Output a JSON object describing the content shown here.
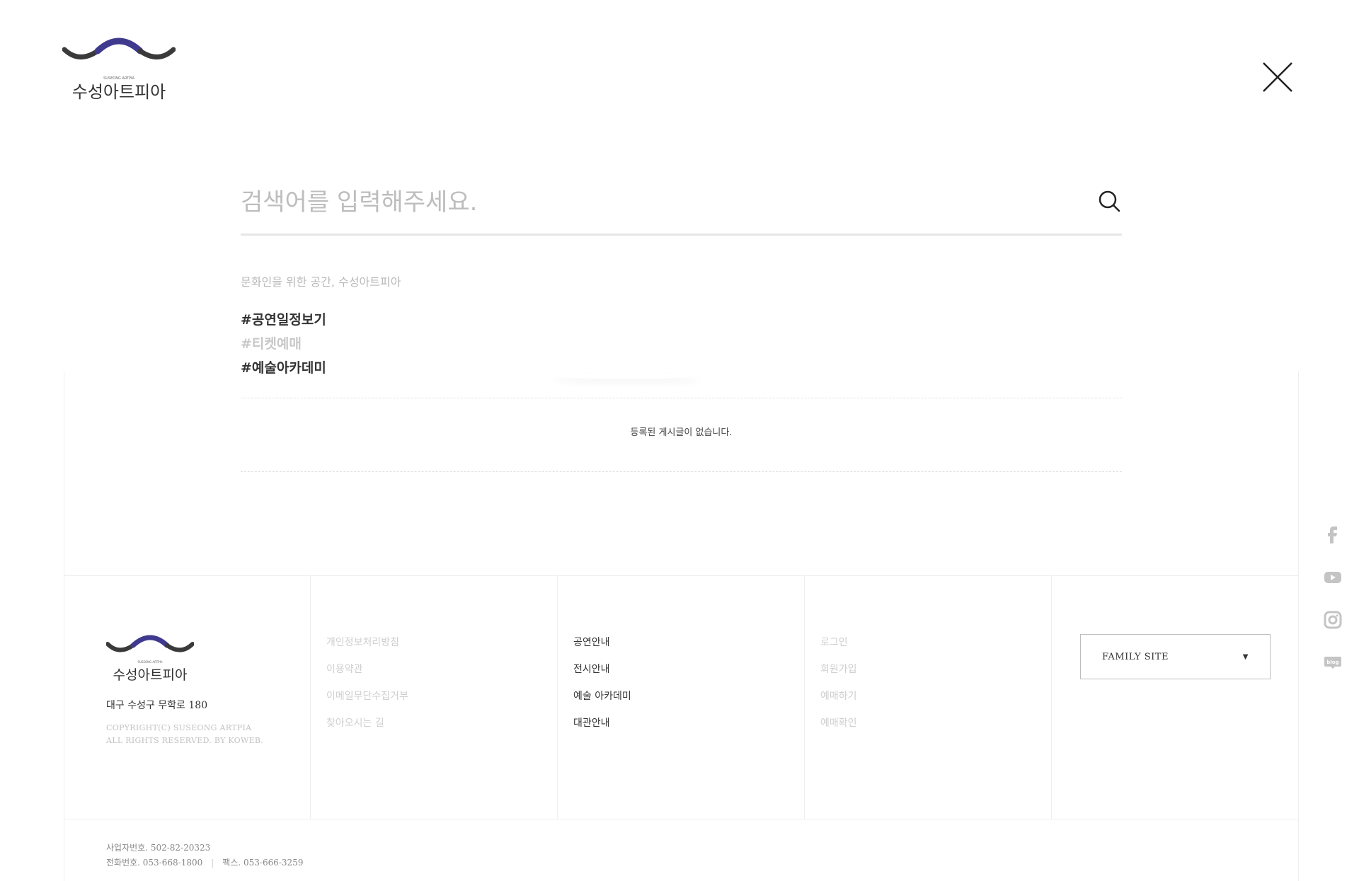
{
  "logo": {
    "subtitle": "SUSEONG ARTPIA",
    "name": "수성아트피아",
    "colors": {
      "arc_left": "#3a3a3a",
      "arc_center": "#3f3a8e",
      "arc_right": "#3a3a3a"
    }
  },
  "search": {
    "placeholder": "검색어를 입력해주세요.",
    "value": "",
    "icon": "search-icon"
  },
  "close": {
    "icon": "close-icon"
  },
  "suggestions": {
    "title": "문화인을 위한 공간, 수성아트피아",
    "tags": [
      {
        "label": "#공연일정보기",
        "style": "dark"
      },
      {
        "label": "#티켓예매",
        "style": "light"
      },
      {
        "label": "#예술아카데미",
        "style": "dark"
      }
    ]
  },
  "board": {
    "empty_message": "등록된 게시글이 없습니다."
  },
  "footer": {
    "address": "대구 수성구 무학로 180",
    "copyright_line1": "COPYRIGHT(C) SUSEONG ARTPIA",
    "copyright_line2": "ALL RIGHTS RESERVED. BY KOWEB.",
    "links_col1": [
      "개인정보처리방침",
      "이용약관",
      "이메일무단수집거부",
      "찾아오시는 길"
    ],
    "links_col2": [
      "공연안내",
      "전시안내",
      "예술 아카데미",
      "대관안내"
    ],
    "links_col3": [
      "로그인",
      "회원가입",
      "예매하기",
      "예매확인"
    ],
    "family_site": {
      "label": "FAMILY SITE",
      "icon": "caret-down-icon"
    },
    "business_no": "사업자번호. 502-82-20323",
    "phone": "전화번호. 053-668-1800",
    "fax": "팩스. 053-666-3259"
  },
  "social": [
    {
      "name": "facebook-icon"
    },
    {
      "name": "youtube-icon"
    },
    {
      "name": "instagram-icon"
    },
    {
      "name": "blog-icon"
    }
  ]
}
